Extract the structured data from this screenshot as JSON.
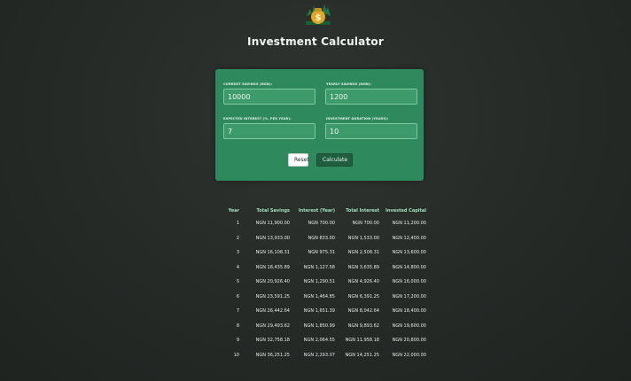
{
  "app": {
    "title": "Investment Calculator",
    "logo_icon": "money-bag-growth-icon"
  },
  "form": {
    "current_savings": {
      "label": "Current Savings (NGN):",
      "value": "10000"
    },
    "yearly_savings": {
      "label": "Yearly Savings (NGN):",
      "value": "1200"
    },
    "expected_interest": {
      "label": "Expected Interest (%, per year):",
      "value": "7"
    },
    "investment_duration": {
      "label": "Investment Duration (years):",
      "value": "10"
    },
    "reset_label": "Reset",
    "calculate_label": "Calculate"
  },
  "colors": {
    "background": "#262a27",
    "card": "#2e8a5d",
    "header_text": "#9fe0bd",
    "calculate_button": "#1f5f40"
  },
  "table": {
    "headers": [
      "Year",
      "Total Savings",
      "Interest (Year)",
      "Total Interest",
      "Invested Capital"
    ],
    "rows": [
      [
        "1",
        "NGN 11,900.00",
        "NGN 700.00",
        "NGN 700.00",
        "NGN 11,200.00"
      ],
      [
        "2",
        "NGN 13,933.00",
        "NGN 833.00",
        "NGN 1,533.00",
        "NGN 12,400.00"
      ],
      [
        "3",
        "NGN 16,108.31",
        "NGN 975.31",
        "NGN 2,508.31",
        "NGN 13,600.00"
      ],
      [
        "4",
        "NGN 18,435.89",
        "NGN 1,127.58",
        "NGN 3,635.89",
        "NGN 14,800.00"
      ],
      [
        "5",
        "NGN 20,926.40",
        "NGN 1,290.51",
        "NGN 4,926.40",
        "NGN 16,000.00"
      ],
      [
        "6",
        "NGN 23,591.25",
        "NGN 1,464.85",
        "NGN 6,391.25",
        "NGN 17,200.00"
      ],
      [
        "7",
        "NGN 26,442.64",
        "NGN 1,651.39",
        "NGN 8,042.64",
        "NGN 18,400.00"
      ],
      [
        "8",
        "NGN 29,493.62",
        "NGN 1,850.99",
        "NGN 9,893.62",
        "NGN 19,600.00"
      ],
      [
        "9",
        "NGN 32,758.18",
        "NGN 2,064.55",
        "NGN 11,958.18",
        "NGN 20,800.00"
      ],
      [
        "10",
        "NGN 36,251.25",
        "NGN 2,293.07",
        "NGN 14,251.25",
        "NGN 22,000.00"
      ]
    ]
  }
}
